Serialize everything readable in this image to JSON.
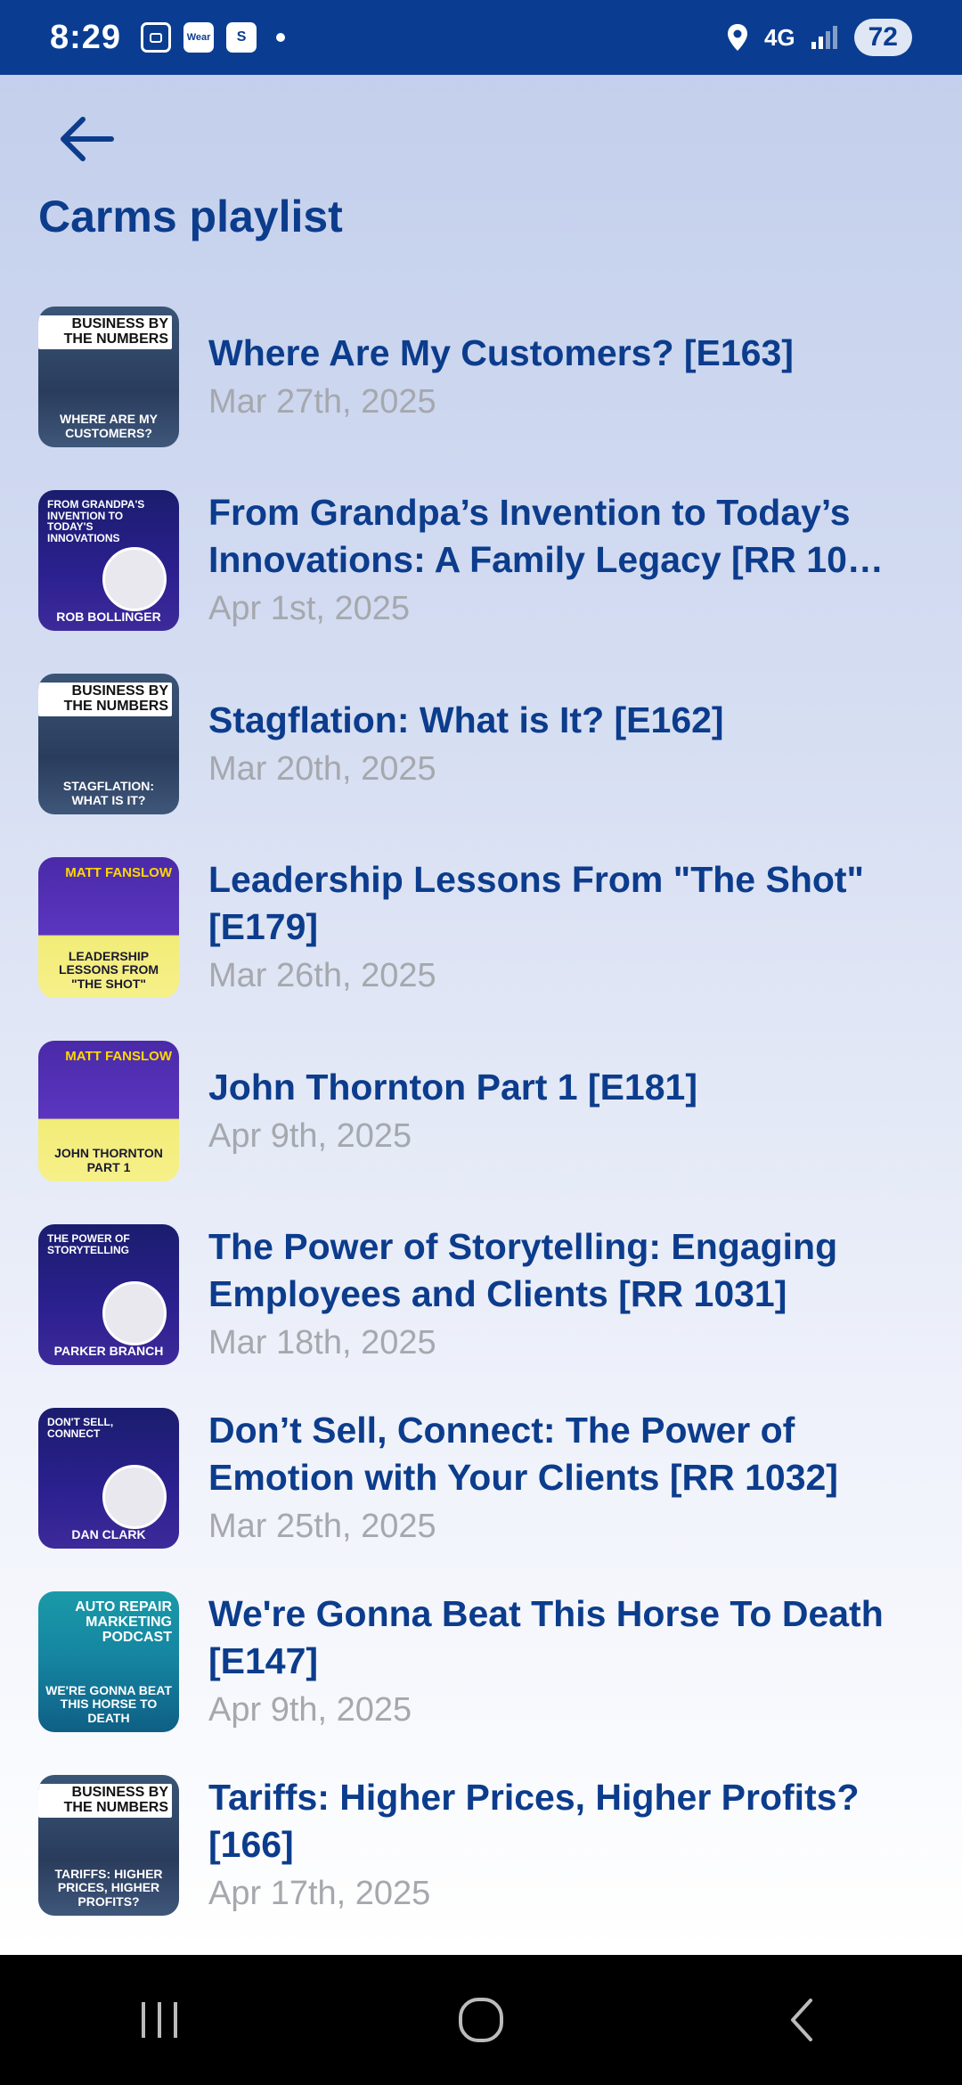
{
  "status_bar": {
    "time": "8:29",
    "network": "4G",
    "battery": "72",
    "left_icons": [
      "screenshot-icon",
      "wear-icon",
      "s-app-icon"
    ],
    "wear_label": "Wear",
    "s_label": "S"
  },
  "header": {
    "title": "Carms playlist"
  },
  "episodes": [
    {
      "title": "Where Are My Customers? [E163]",
      "date": "Mar 27th, 2025",
      "thumb_style": "bbtn",
      "thumb_head": "Business by the Numbers",
      "thumb_caption": "Where Are My Customers?"
    },
    {
      "title": "From Grandpa’s Invention to Today’s Innovations: A Family Legacy [RR 10…",
      "date": "Apr 1st, 2025",
      "thumb_style": "podcast",
      "thumb_head": "From Grandpa's Invention to Today's Innovations",
      "thumb_caption": "Rob Bollinger"
    },
    {
      "title": "Stagflation: What is It? [E162]",
      "date": "Mar 20th, 2025",
      "thumb_style": "bbtn",
      "thumb_head": "Business by the Numbers",
      "thumb_caption": "Stagflation: What is It?"
    },
    {
      "title": "Leadership Lessons From \"The Shot\" [E179]",
      "date": "Mar 26th, 2025",
      "thumb_style": "fanslow",
      "thumb_head": "Matt Fanslow",
      "thumb_caption": "Leadership Lessons From \"The Shot\""
    },
    {
      "title": "John Thornton Part 1 [E181]",
      "date": "Apr 9th, 2025",
      "thumb_style": "fanslow",
      "thumb_head": "Matt Fanslow",
      "thumb_caption": "John Thornton Part 1"
    },
    {
      "title": "The Power of Storytelling: Engaging Employees and Clients [RR 1031]",
      "date": "Mar 18th, 2025",
      "thumb_style": "podcast",
      "thumb_head": "The Power of Storytelling",
      "thumb_caption": "Parker Branch"
    },
    {
      "title": "Don’t Sell, Connect: The Power of Emotion with Your Clients [RR 1032]",
      "date": "Mar 25th, 2025",
      "thumb_style": "podcast",
      "thumb_head": "Don't Sell, Connect",
      "thumb_caption": "Dan Clark"
    },
    {
      "title": "We're Gonna Beat This Horse To Death [E147]",
      "date": "Apr 9th, 2025",
      "thumb_style": "teal",
      "thumb_head": "Auto Repair Marketing Podcast",
      "thumb_caption": "We're Gonna Beat This Horse To Death"
    },
    {
      "title": "Tariffs: Higher Prices, Higher Profits? [166]",
      "date": "Apr 17th, 2025",
      "thumb_style": "bbtn",
      "thumb_head": "Business by the Numbers",
      "thumb_caption": "Tariffs: Higher Prices, Higher Profits?"
    }
  ],
  "colors": {
    "status_bar": "#0a3d91",
    "title": "#0c3c8c",
    "date": "#a5a8ad"
  }
}
